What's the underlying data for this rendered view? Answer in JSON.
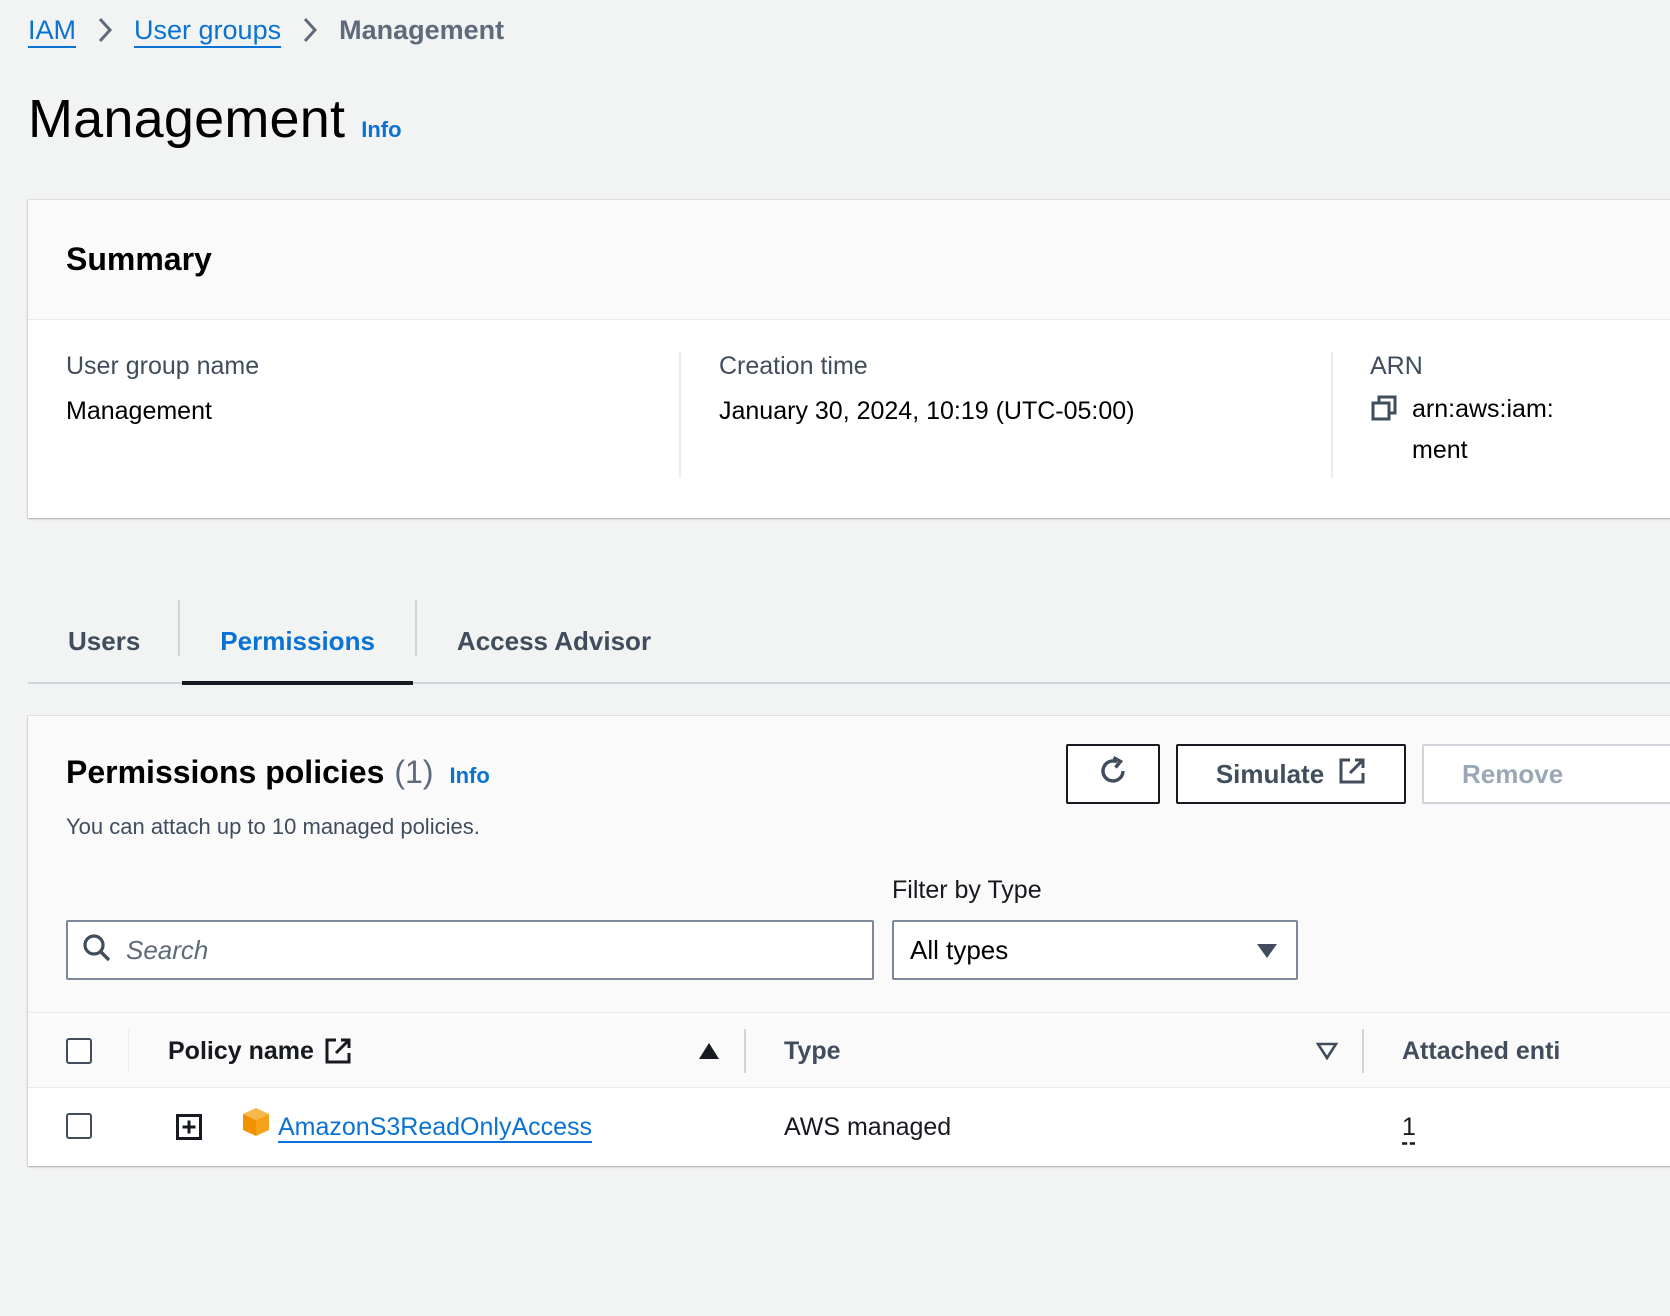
{
  "breadcrumb": {
    "items": [
      {
        "label": "IAM"
      },
      {
        "label": "User groups"
      }
    ],
    "current": "Management"
  },
  "page": {
    "title": "Management",
    "info": "Info"
  },
  "summary": {
    "title": "Summary",
    "group_name_label": "User group name",
    "group_name_value": "Management",
    "creation_label": "Creation time",
    "creation_value": "January 30, 2024, 10:19 (UTC-05:00)",
    "arn_label": "ARN",
    "arn_line1": "arn:aws:iam:",
    "arn_line2": "ment"
  },
  "tabs": [
    {
      "label": "Users",
      "active": false
    },
    {
      "label": "Permissions",
      "active": true
    },
    {
      "label": "Access Advisor",
      "active": false
    }
  ],
  "permissions": {
    "title": "Permissions policies",
    "count": "(1)",
    "info": "Info",
    "description": "You can attach up to 10 managed policies.",
    "simulate_label": "Simulate",
    "remove_label": "Remove",
    "search_placeholder": "Search",
    "filter_label": "Filter by Type",
    "filter_value": "All types",
    "columns": {
      "policy_name": "Policy name",
      "type": "Type",
      "attached": "Attached enti"
    },
    "rows": [
      {
        "policy_name": "AmazonS3ReadOnlyAccess",
        "type": "AWS managed",
        "attached": "1"
      }
    ]
  },
  "colors": {
    "link": "#0972d3",
    "s3_icon": "#f5a11a"
  }
}
